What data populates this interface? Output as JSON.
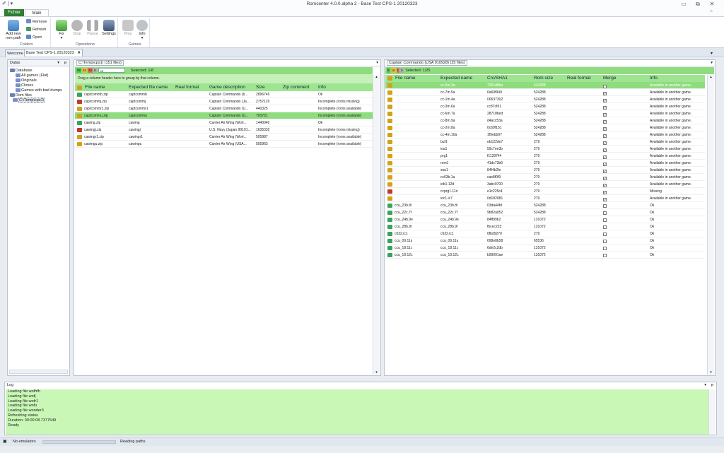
{
  "app": {
    "title": "Romcenter 4.0.0.alpha 2 - Base Test CPS-1 20120323"
  },
  "ribbon": {
    "tabs": [
      "Fichier",
      "Main"
    ],
    "folders": {
      "add_new": "Add new",
      "rom_path": "rom path",
      "remove": "Remove",
      "refresh": "Refresh",
      "open": "Open",
      "label": "Folders"
    },
    "operations": {
      "fix": "Fix",
      "stop": "Stop",
      "pause": "Pause",
      "settings": "Settings",
      "label": "Operations"
    },
    "games": {
      "play": "Play",
      "info": "Info",
      "label": "Games"
    }
  },
  "doc_tabs": [
    "Welcome",
    "Base Test CPS-1 20120323"
  ],
  "datas": {
    "title": "Datas",
    "tree": [
      {
        "label": "Database",
        "level": 0
      },
      {
        "label": "All games (Flat)",
        "level": 2
      },
      {
        "label": "Originals",
        "level": 2
      },
      {
        "label": "Clones",
        "level": 2
      },
      {
        "label": "Games with bad dumps",
        "level": 2
      },
      {
        "label": "Rom files",
        "level": 0
      },
      {
        "label": "C:\\Temp\\cps1\\",
        "level": 1
      }
    ]
  },
  "files": {
    "tab": "C:\\Temp\\cps1\\ (151 files)",
    "counts": [
      "99",
      "52",
      "46",
      "0"
    ],
    "filter": "ca",
    "selected": "Selected: 1/8",
    "group_hint": "Drag a column header here to group by that column.",
    "columns": [
      "File name",
      "Expected file name",
      "Real format",
      "Game description",
      "Size",
      "Zip comment",
      "Info"
    ],
    "rows": [
      {
        "name": "captcommb.zip",
        "expected": "captcommb",
        "desc": "Captain Commando (b...",
        "size": "2896749",
        "info": "Ok",
        "icon": "#3aa35a",
        "sel": false
      },
      {
        "name": "captcommj.zip",
        "expected": "captcommj",
        "desc": "Captain Commando (Ja...",
        "size": "2757129",
        "info": "Incomplete (roms missing)",
        "icon": "#c0392b",
        "sel": false
      },
      {
        "name": "captcommr1.zip",
        "expected": "captcommr1",
        "desc": "Captain Commando (U...",
        "size": "440325",
        "info": "Incomplete (roms available)",
        "icon": "#d4a017",
        "sel": false
      },
      {
        "name": "captcommu.zip",
        "expected": "captcommu",
        "desc": "Captain Commando (U...",
        "size": "703721",
        "info": "Incomplete (roms available)",
        "icon": "#d4a017",
        "sel": true
      },
      {
        "name": "cawing.zip",
        "expected": "cawing",
        "desc": "Carrier Air Wing (Worl...",
        "size": "1440040",
        "info": "Ok",
        "icon": "#3aa35a",
        "sel": false
      },
      {
        "name": "cawingj.zip",
        "expected": "cawingj",
        "desc": "U.S. Navy (Japan 90101...",
        "size": "1635332",
        "info": "Incomplete (roms missing)",
        "icon": "#c0392b",
        "sel": false
      },
      {
        "name": "cawingr1.zip",
        "expected": "cawingr1",
        "desc": "Carrier Air Wing (Worl...",
        "size": "505987",
        "info": "Incomplete (roms available)",
        "icon": "#d4a017",
        "sel": false
      },
      {
        "name": "cawingu.zip",
        "expected": "cawingu",
        "desc": "Carrier Air Wing (USA...",
        "size": "505963",
        "info": "Incomplete (roms available)",
        "icon": "#d4a017",
        "sel": false
      }
    ]
  },
  "roms": {
    "tab": "Captain Commando (USA 910928) (25 files)",
    "counts": [
      "8",
      "16",
      "1",
      "0"
    ],
    "selected": "Selected: 1/25",
    "columns": [
      "File name",
      "Expected name",
      "Crc/SHA1",
      "Rom size",
      "Real format",
      "Merge",
      "Info"
    ],
    "rows": [
      {
        "name": "",
        "expected": "cc-5m.3a",
        "crc": "7261d8ba",
        "size": "524288",
        "merge": true,
        "info": "Available in another game.",
        "icon": "#d4a017",
        "sel": true
      },
      {
        "name": "",
        "expected": "cc-7m.5a",
        "crc": "6a60f949",
        "size": "524288",
        "merge": true,
        "info": "Available in another game.",
        "icon": "#d4a017",
        "sel": false
      },
      {
        "name": "",
        "expected": "cc-1m.4a",
        "crc": "00637302",
        "size": "524288",
        "merge": true,
        "info": "Available in another game.",
        "icon": "#d4a017",
        "sel": false
      },
      {
        "name": "",
        "expected": "cc-3m.6a",
        "crc": "cc87cf61",
        "size": "524288",
        "merge": true,
        "info": "Available in another game.",
        "icon": "#d4a017",
        "sel": false
      },
      {
        "name": "",
        "expected": "cc-6m.7a",
        "crc": "28718bed",
        "size": "524288",
        "merge": true,
        "info": "Available in another game.",
        "icon": "#d4a017",
        "sel": false
      },
      {
        "name": "",
        "expected": "cc-8m.9a",
        "crc": "d4acc53a",
        "size": "524288",
        "merge": true,
        "info": "Available in another game.",
        "icon": "#d4a017",
        "sel": false
      },
      {
        "name": "",
        "expected": "cc-2m.8a",
        "crc": "0c69f151",
        "size": "524288",
        "merge": true,
        "info": "Available in another game.",
        "icon": "#d4a017",
        "sel": false
      },
      {
        "name": "",
        "expected": "cc-4m.10a",
        "crc": "1f9ebb97",
        "size": "524288",
        "merge": true,
        "info": "Available in another game.",
        "icon": "#d4a017",
        "sel": false
      },
      {
        "name": "",
        "expected": "buf1",
        "crc": "eb122de7",
        "size": "279",
        "merge": true,
        "info": "Available in another game.",
        "icon": "#d4a017",
        "sel": false
      },
      {
        "name": "",
        "expected": "ioa1",
        "crc": "59c7ee3b",
        "size": "279",
        "merge": true,
        "info": "Available in another game.",
        "icon": "#d4a017",
        "sel": false
      },
      {
        "name": "",
        "expected": "prg1",
        "crc": "f1129744",
        "size": "279",
        "merge": true,
        "info": "Available in another game.",
        "icon": "#d4a017",
        "sel": false
      },
      {
        "name": "",
        "expected": "rom1",
        "crc": "41dc73b9",
        "size": "279",
        "merge": true,
        "info": "Available in another game.",
        "icon": "#d4a017",
        "sel": false
      },
      {
        "name": "",
        "expected": "sou1",
        "crc": "84f4b2fe",
        "size": "279",
        "merge": true,
        "info": "Available in another game.",
        "icon": "#d4a017",
        "sel": false
      },
      {
        "name": "",
        "expected": "cc63b.1a",
        "crc": "cae8f0f9",
        "size": "279",
        "merge": true,
        "info": "Available in another game.",
        "icon": "#d4a017",
        "sel": false
      },
      {
        "name": "",
        "expected": "iob1.12d",
        "crc": "3abc0700",
        "size": "279",
        "merge": true,
        "info": "Available in another game.",
        "icon": "#d4a017",
        "sel": false
      },
      {
        "name": "",
        "expected": "ccprg1.11d",
        "crc": "e1c225c4",
        "size": "279",
        "merge": true,
        "info": "Missing.",
        "icon": "#c0392b",
        "sel": false
      },
      {
        "name": "",
        "expected": "ioc1.ic7",
        "crc": "0d182081",
        "size": "279",
        "merge": true,
        "info": "Available in another game.",
        "icon": "#d4a017",
        "sel": false
      },
      {
        "name": "ccu_23b.8f",
        "expected": "ccu_23b.8f",
        "crc": "03da44fd",
        "size": "524288",
        "merge": false,
        "info": "Ok",
        "icon": "#3aa35a",
        "sel": false
      },
      {
        "name": "ccu_22c.7f",
        "expected": "ccu_22c.7f",
        "crc": "9b82a052",
        "size": "524288",
        "merge": false,
        "info": "Ok",
        "icon": "#3aa35a",
        "sel": false
      },
      {
        "name": "ccu_24b.9e",
        "expected": "ccu_24b.9e",
        "crc": "84ff99b2",
        "size": "131072",
        "merge": false,
        "info": "Ok",
        "icon": "#3aa35a",
        "sel": false
      },
      {
        "name": "ccu_28b.9f",
        "expected": "ccu_28b.9f",
        "crc": "fbcec223",
        "size": "131072",
        "merge": false,
        "info": "Ok",
        "icon": "#3aa35a",
        "sel": false
      },
      {
        "name": "c632.ic1",
        "expected": "c632.ic1",
        "crc": "0fbd9270",
        "size": "279",
        "merge": false,
        "info": "Ok",
        "icon": "#3aa35a",
        "sel": false
      },
      {
        "name": "ccu_09.11a",
        "expected": "ccu_09.11a",
        "crc": "698e8b58",
        "size": "65536",
        "merge": false,
        "info": "Ok",
        "icon": "#3aa35a",
        "sel": false
      },
      {
        "name": "ccu_18.11c",
        "expected": "ccu_18.11c",
        "crc": "6de2c2db",
        "size": "131072",
        "merge": false,
        "info": "Ok",
        "icon": "#3aa35a",
        "sel": false
      },
      {
        "name": "ccu_19.12c",
        "expected": "ccu_19.12c",
        "crc": "b99091ae",
        "size": "131072",
        "merge": false,
        "info": "Ok",
        "icon": "#3aa35a",
        "sel": false
      }
    ]
  },
  "log": {
    "title": "Log",
    "lines": [
      "Loading file wofhfh",
      "Loading file wofj",
      "Loading file wofr1",
      "Loading file wofu",
      "Loading file wonder3",
      "Refreshing status",
      "Duration: 00:00:08.7377549",
      "Ready"
    ]
  },
  "status": {
    "emulators": "No emulators",
    "reading": "Reading paths"
  },
  "colors": {
    "green_header": "#9ee592",
    "selected_row": "#8fdc7e",
    "log_bg": "#c9f8b6",
    "fichier_tab": "#2e7d32"
  }
}
